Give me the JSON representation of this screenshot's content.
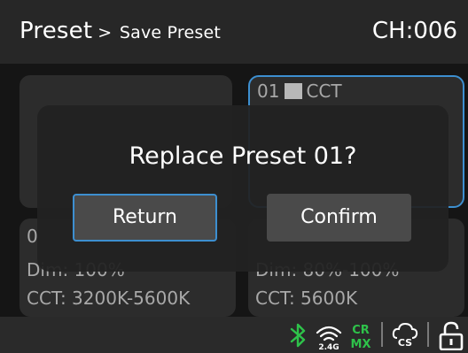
{
  "header": {
    "title": "Preset",
    "separator": ">",
    "breadcrumb": "Save Preset",
    "channel": "CH:006"
  },
  "presets": [
    {
      "label": "",
      "mode": ""
    },
    {
      "number": "01",
      "mode": "CCT",
      "selected": true
    },
    {
      "number": "0",
      "dim": "Dim: 100%",
      "cct": "CCT: 3200K-5600K"
    },
    {
      "number": "",
      "dim": "Dim: 80%-100%",
      "cct": "CCT: 5600K"
    }
  ],
  "dialog": {
    "title": "Replace Preset 01?",
    "return_label": "Return",
    "confirm_label": "Confirm"
  },
  "status_bar": {
    "bluetooth_icon": "bluetooth-icon",
    "wireless_band": "2.4G",
    "crmx_top": "CR",
    "crmx_bottom": "MX",
    "cs_icon": "CS",
    "lock_icon": "lock-icon",
    "accent_green": "#2ec24a"
  }
}
